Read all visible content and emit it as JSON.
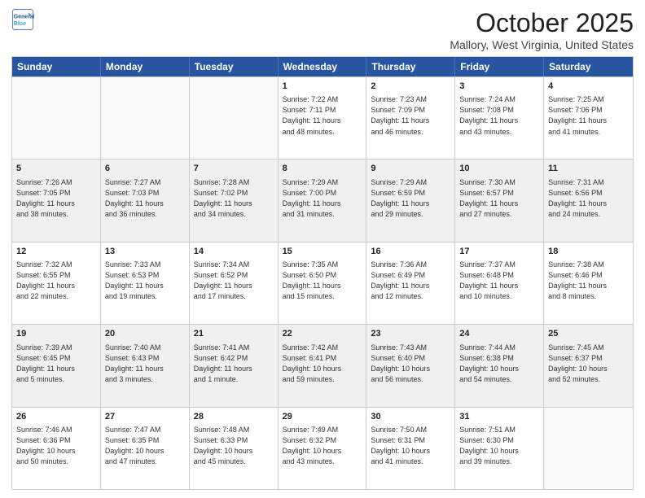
{
  "header": {
    "logo_line1": "General",
    "logo_line2": "Blue",
    "month": "October 2025",
    "location": "Mallory, West Virginia, United States"
  },
  "weekdays": [
    "Sunday",
    "Monday",
    "Tuesday",
    "Wednesday",
    "Thursday",
    "Friday",
    "Saturday"
  ],
  "rows": [
    [
      {
        "day": "",
        "text": "",
        "empty": true
      },
      {
        "day": "",
        "text": "",
        "empty": true
      },
      {
        "day": "",
        "text": "",
        "empty": true
      },
      {
        "day": "1",
        "text": "Sunrise: 7:22 AM\nSunset: 7:11 PM\nDaylight: 11 hours\nand 48 minutes."
      },
      {
        "day": "2",
        "text": "Sunrise: 7:23 AM\nSunset: 7:09 PM\nDaylight: 11 hours\nand 46 minutes."
      },
      {
        "day": "3",
        "text": "Sunrise: 7:24 AM\nSunset: 7:08 PM\nDaylight: 11 hours\nand 43 minutes."
      },
      {
        "day": "4",
        "text": "Sunrise: 7:25 AM\nSunset: 7:06 PM\nDaylight: 11 hours\nand 41 minutes."
      }
    ],
    [
      {
        "day": "5",
        "text": "Sunrise: 7:26 AM\nSunset: 7:05 PM\nDaylight: 11 hours\nand 38 minutes.",
        "shaded": true
      },
      {
        "day": "6",
        "text": "Sunrise: 7:27 AM\nSunset: 7:03 PM\nDaylight: 11 hours\nand 36 minutes.",
        "shaded": true
      },
      {
        "day": "7",
        "text": "Sunrise: 7:28 AM\nSunset: 7:02 PM\nDaylight: 11 hours\nand 34 minutes.",
        "shaded": true
      },
      {
        "day": "8",
        "text": "Sunrise: 7:29 AM\nSunset: 7:00 PM\nDaylight: 11 hours\nand 31 minutes.",
        "shaded": true
      },
      {
        "day": "9",
        "text": "Sunrise: 7:29 AM\nSunset: 6:59 PM\nDaylight: 11 hours\nand 29 minutes.",
        "shaded": true
      },
      {
        "day": "10",
        "text": "Sunrise: 7:30 AM\nSunset: 6:57 PM\nDaylight: 11 hours\nand 27 minutes.",
        "shaded": true
      },
      {
        "day": "11",
        "text": "Sunrise: 7:31 AM\nSunset: 6:56 PM\nDaylight: 11 hours\nand 24 minutes.",
        "shaded": true
      }
    ],
    [
      {
        "day": "12",
        "text": "Sunrise: 7:32 AM\nSunset: 6:55 PM\nDaylight: 11 hours\nand 22 minutes."
      },
      {
        "day": "13",
        "text": "Sunrise: 7:33 AM\nSunset: 6:53 PM\nDaylight: 11 hours\nand 19 minutes."
      },
      {
        "day": "14",
        "text": "Sunrise: 7:34 AM\nSunset: 6:52 PM\nDaylight: 11 hours\nand 17 minutes."
      },
      {
        "day": "15",
        "text": "Sunrise: 7:35 AM\nSunset: 6:50 PM\nDaylight: 11 hours\nand 15 minutes."
      },
      {
        "day": "16",
        "text": "Sunrise: 7:36 AM\nSunset: 6:49 PM\nDaylight: 11 hours\nand 12 minutes."
      },
      {
        "day": "17",
        "text": "Sunrise: 7:37 AM\nSunset: 6:48 PM\nDaylight: 11 hours\nand 10 minutes."
      },
      {
        "day": "18",
        "text": "Sunrise: 7:38 AM\nSunset: 6:46 PM\nDaylight: 11 hours\nand 8 minutes."
      }
    ],
    [
      {
        "day": "19",
        "text": "Sunrise: 7:39 AM\nSunset: 6:45 PM\nDaylight: 11 hours\nand 5 minutes.",
        "shaded": true
      },
      {
        "day": "20",
        "text": "Sunrise: 7:40 AM\nSunset: 6:43 PM\nDaylight: 11 hours\nand 3 minutes.",
        "shaded": true
      },
      {
        "day": "21",
        "text": "Sunrise: 7:41 AM\nSunset: 6:42 PM\nDaylight: 11 hours\nand 1 minute.",
        "shaded": true
      },
      {
        "day": "22",
        "text": "Sunrise: 7:42 AM\nSunset: 6:41 PM\nDaylight: 10 hours\nand 59 minutes.",
        "shaded": true
      },
      {
        "day": "23",
        "text": "Sunrise: 7:43 AM\nSunset: 6:40 PM\nDaylight: 10 hours\nand 56 minutes.",
        "shaded": true
      },
      {
        "day": "24",
        "text": "Sunrise: 7:44 AM\nSunset: 6:38 PM\nDaylight: 10 hours\nand 54 minutes.",
        "shaded": true
      },
      {
        "day": "25",
        "text": "Sunrise: 7:45 AM\nSunset: 6:37 PM\nDaylight: 10 hours\nand 52 minutes.",
        "shaded": true
      }
    ],
    [
      {
        "day": "26",
        "text": "Sunrise: 7:46 AM\nSunset: 6:36 PM\nDaylight: 10 hours\nand 50 minutes."
      },
      {
        "day": "27",
        "text": "Sunrise: 7:47 AM\nSunset: 6:35 PM\nDaylight: 10 hours\nand 47 minutes."
      },
      {
        "day": "28",
        "text": "Sunrise: 7:48 AM\nSunset: 6:33 PM\nDaylight: 10 hours\nand 45 minutes."
      },
      {
        "day": "29",
        "text": "Sunrise: 7:49 AM\nSunset: 6:32 PM\nDaylight: 10 hours\nand 43 minutes."
      },
      {
        "day": "30",
        "text": "Sunrise: 7:50 AM\nSunset: 6:31 PM\nDaylight: 10 hours\nand 41 minutes."
      },
      {
        "day": "31",
        "text": "Sunrise: 7:51 AM\nSunset: 6:30 PM\nDaylight: 10 hours\nand 39 minutes."
      },
      {
        "day": "",
        "text": "",
        "empty": true
      }
    ]
  ]
}
